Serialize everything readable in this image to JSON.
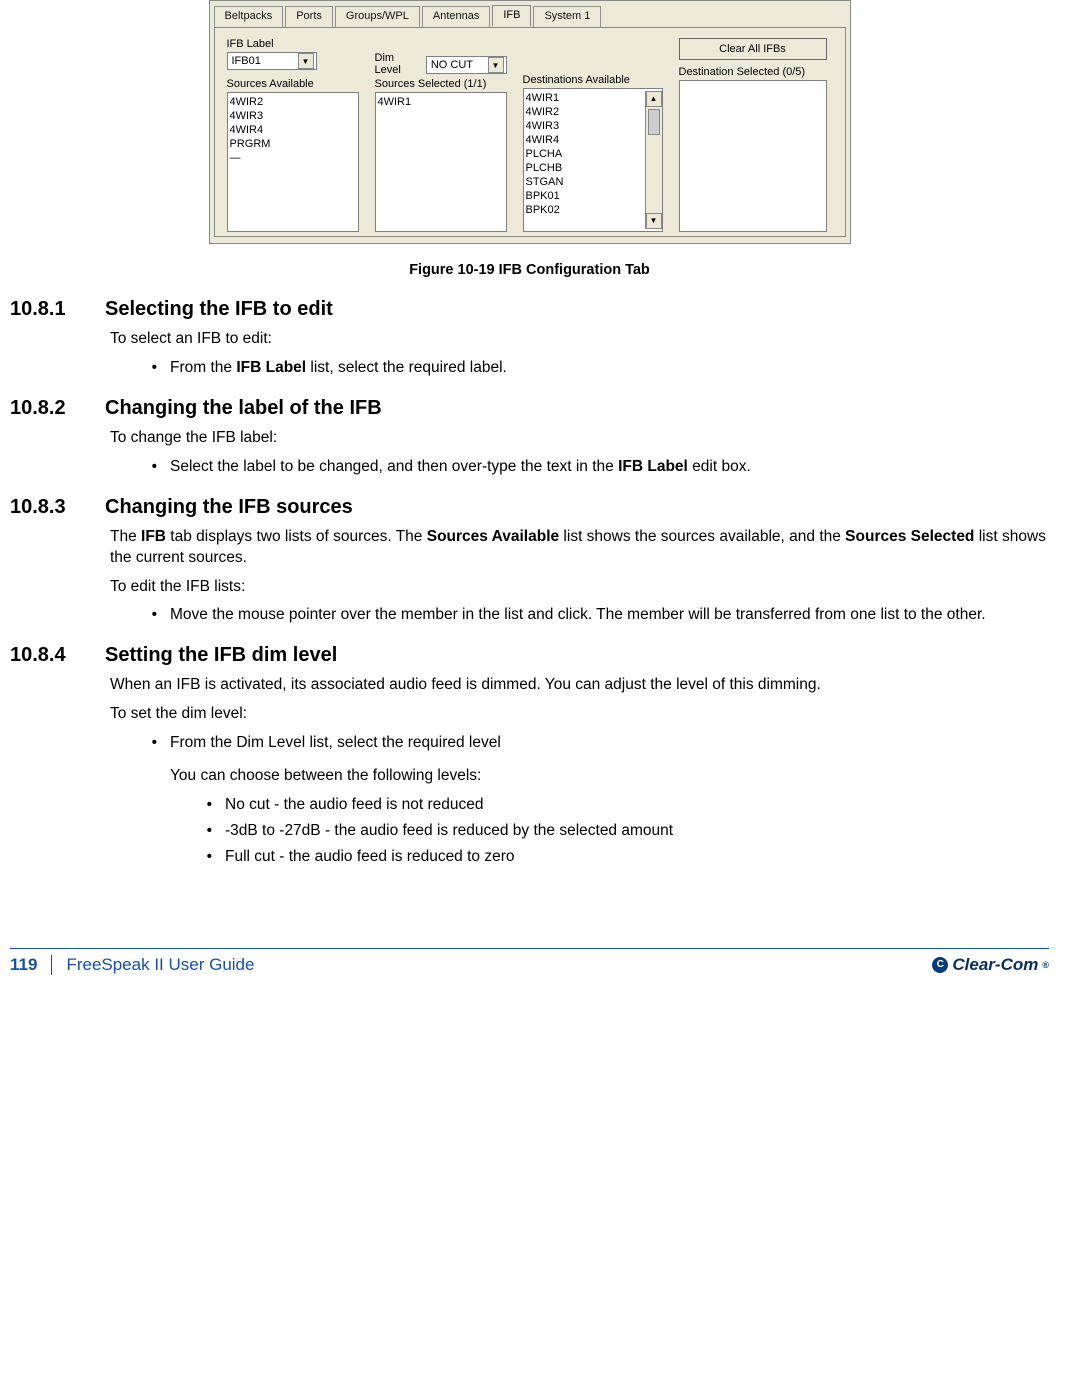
{
  "dialog": {
    "tabs": [
      "Beltpacks",
      "Ports",
      "Groups/WPL",
      "Antennas",
      "IFB",
      "System 1"
    ],
    "active_tab_index": 4,
    "ifb_label_title": "IFB Label",
    "ifb_label_value": "IFB01",
    "dim_level_title": "Dim Level",
    "dim_level_value": "NO CUT",
    "sources_available_title": "Sources Available",
    "sources_available": [
      "4WIR2",
      "4WIR3",
      "4WIR4",
      "PRGRM",
      "—"
    ],
    "sources_selected_title": "Sources Selected (1/1)",
    "sources_selected": [
      "4WIR1"
    ],
    "destinations_available_title": "Destinations Available",
    "destinations_available": [
      "4WIR1",
      "4WIR2",
      "4WIR3",
      "4WIR4",
      "PLCHA",
      "PLCHB",
      "STGAN",
      "BPK01",
      "BPK02"
    ],
    "destination_selected_title": "Destination Selected (0/5)",
    "destination_selected": [],
    "clear_button": "Clear All IFBs"
  },
  "figure_caption": "Figure 10-19 IFB Configuration Tab",
  "sections": {
    "s1": {
      "num": "10.8.1",
      "title": "Selecting the IFB to edit",
      "intro": "To select an IFB to edit:",
      "bullet_prefix": "From the ",
      "bullet_bold": "IFB Label",
      "bullet_suffix": " list, select the required label."
    },
    "s2": {
      "num": "10.8.2",
      "title": "Changing the label of the IFB",
      "intro": "To change the IFB label:",
      "bullet_prefix": "Select the label to be changed, and then over-type the text in the ",
      "bullet_bold": "IFB Label",
      "bullet_suffix": " edit box."
    },
    "s3": {
      "num": "10.8.3",
      "title": "Changing the IFB sources",
      "para_prefix": "The ",
      "para_b1": "IFB",
      "para_mid1": " tab displays two lists of sources. The ",
      "para_b2": "Sources Available",
      "para_mid2": " list shows the sources available, and the ",
      "para_b3": "Sources Selected",
      "para_suffix": " list shows the current sources.",
      "intro2": "To edit the IFB lists:",
      "bullet": "Move the mouse pointer over the member in the list and click. The member will be transferred from one list to the other."
    },
    "s4": {
      "num": "10.8.4",
      "title": "Setting the IFB dim level",
      "para": "When an IFB is activated, its associated audio feed is dimmed. You can adjust the level of this dimming.",
      "intro": "To set the dim level:",
      "bullet": "From the Dim Level list, select the required level",
      "sub_intro": "You can choose between the following levels:",
      "sub1": "No cut - the audio feed is not reduced",
      "sub2": "-3dB to -27dB - the audio feed is reduced by the selected amount",
      "sub3": "Full cut - the audio feed is reduced to zero"
    }
  },
  "footer": {
    "page": "119",
    "guide": "FreeSpeak II User Guide",
    "brand": "Clear-Com"
  }
}
